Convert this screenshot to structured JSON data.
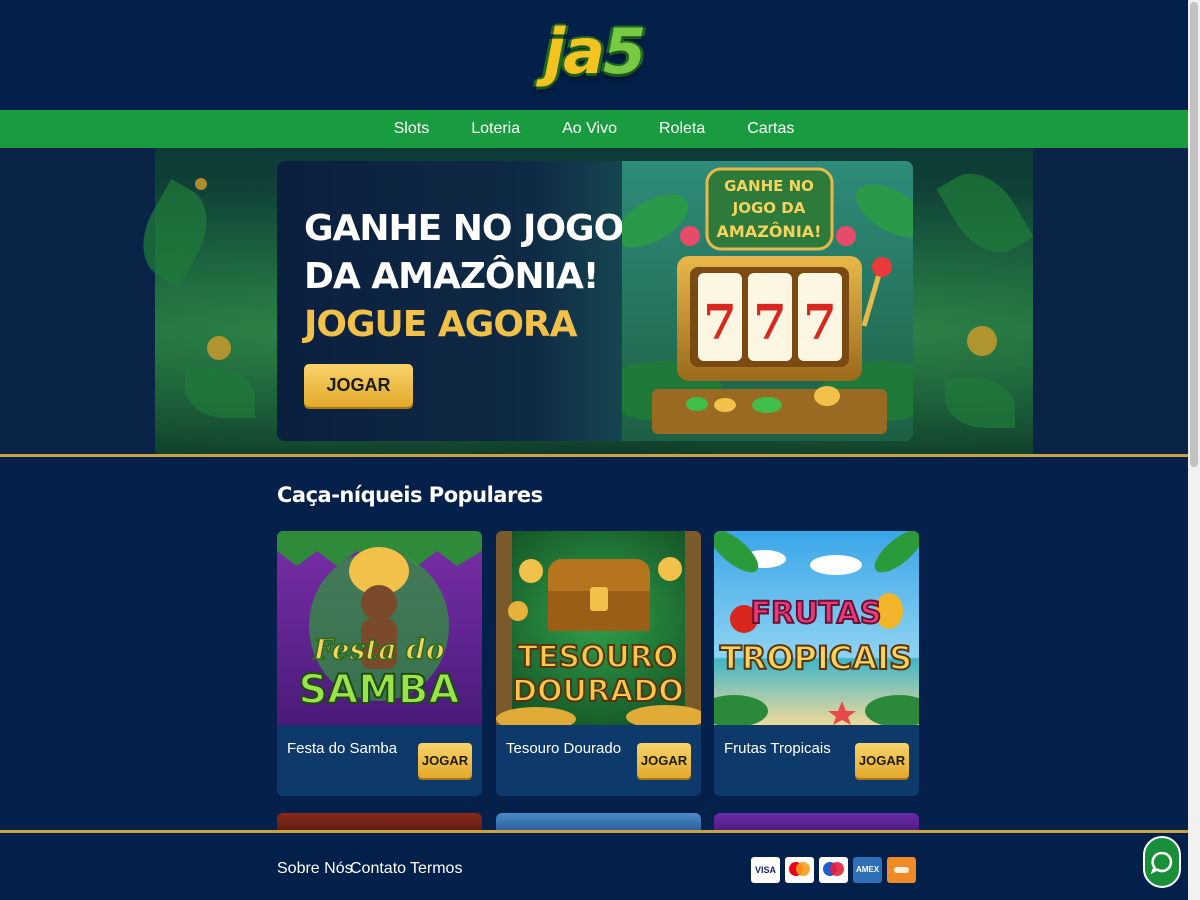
{
  "header": {
    "logo_ja": "ja",
    "logo_5": "5"
  },
  "nav": {
    "items": [
      "Slots",
      "Loteria",
      "Ao Vivo",
      "Roleta",
      "Cartas"
    ]
  },
  "hero": {
    "line1": "GANHE NO JOGO",
    "line2": "DA AMAZÔNIA!",
    "line3": "JOGUE AGORA",
    "cta": "JOGAR",
    "art_title": [
      "GANHE NO",
      "JOGO DA",
      "AMAZÔNIA!"
    ],
    "reels": [
      "7",
      "7",
      "7"
    ]
  },
  "main": {
    "section_title": "Caça-níqueis Populares",
    "cards": [
      {
        "name": "Festa do Samba",
        "thumb_line1": "Festa do",
        "thumb_line2": "SAMBA",
        "button": "JOGAR"
      },
      {
        "name": "Tesouro Dourado",
        "thumb_line1": "TESOURO",
        "thumb_line2": "DOURADO",
        "button": "JOGAR"
      },
      {
        "name": "Frutas Tropicais",
        "thumb_line1": "FRUTAS",
        "thumb_line2": "TROPICAIS",
        "button": "JOGAR"
      }
    ]
  },
  "footer": {
    "links": [
      "Sobre Nós",
      "Contato",
      "Termos"
    ],
    "payments": [
      "VISA",
      "mastercard-icon",
      "maestro-icon",
      "AMEX",
      "pix-icon"
    ],
    "visa_label": "VISA",
    "amex_label": "AMEX"
  },
  "colors": {
    "background": "#05204a",
    "nav": "#199c3f",
    "gold": "#f2c14a",
    "card": "#0e3a6b",
    "divider": "#c8a243"
  }
}
